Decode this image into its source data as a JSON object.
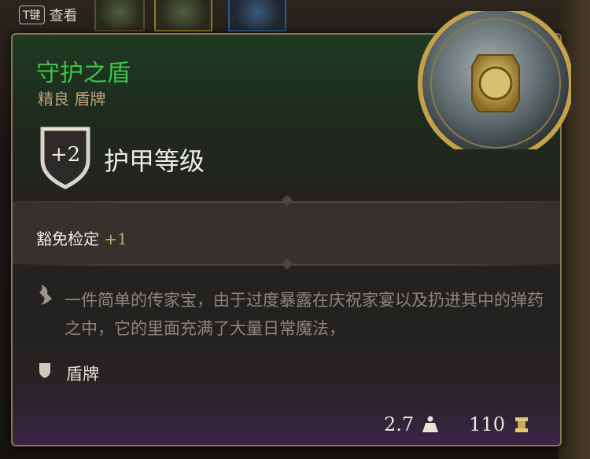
{
  "hint": {
    "key": "T键",
    "label": "查看"
  },
  "item": {
    "name": "守护之盾",
    "rarity_type": "精良 盾牌",
    "armor_class_value": "+2",
    "armor_class_label": "护甲等级",
    "saving_throw_label": "豁免检定",
    "saving_throw_value": "+1",
    "description": "一件简单的传家宝，由于过度暴露在庆祝家宴以及扔进其中的弹药之中，它的里面充满了大量日常魔法，",
    "type_label": "盾牌",
    "weight": "2.7",
    "value": "110"
  },
  "colors": {
    "name": "#3ec24a",
    "rarity": "#b9a07a",
    "border": "#8b7653",
    "bonus": "#c9a577"
  },
  "icons": [
    "shield-ac-icon",
    "quill-icon",
    "shield-type-icon",
    "weight-icon",
    "gold-icon",
    "item-shield-image"
  ]
}
